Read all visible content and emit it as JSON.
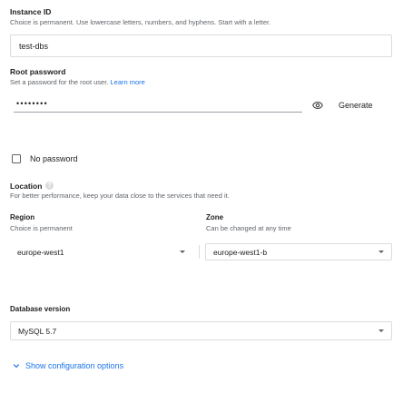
{
  "instance_id": {
    "label": "Instance ID",
    "helper": "Choice is permanent. Use lowercase letters, numbers, and hyphens. Start with a letter.",
    "value": "test-dbs"
  },
  "root_password": {
    "label": "Root password",
    "helper": "Set a password for the root user.",
    "learn_more": "Learn more",
    "masked_value": "••••••••",
    "generate_label": "Generate",
    "generate_icon": "eye-icon"
  },
  "no_password": {
    "label": "No password",
    "checked": false
  },
  "location": {
    "label": "Location",
    "help_icon": "help-icon",
    "helper": "For better performance, keep your data close to the services that need it."
  },
  "region": {
    "label": "Region",
    "helper": "Choice is permanent",
    "value": "europe-west1"
  },
  "zone": {
    "label": "Zone",
    "helper": "Can be changed at any time",
    "value": "europe-west1-b"
  },
  "database_version": {
    "label": "Database version",
    "value": "MySQL 5.7"
  },
  "config_toggle": {
    "label": "Show configuration options",
    "icon": "chevron-down-icon"
  },
  "colors": {
    "link": "#1a73e8",
    "border": "#dadce0",
    "text": "#202124",
    "muted": "#5f6368"
  }
}
